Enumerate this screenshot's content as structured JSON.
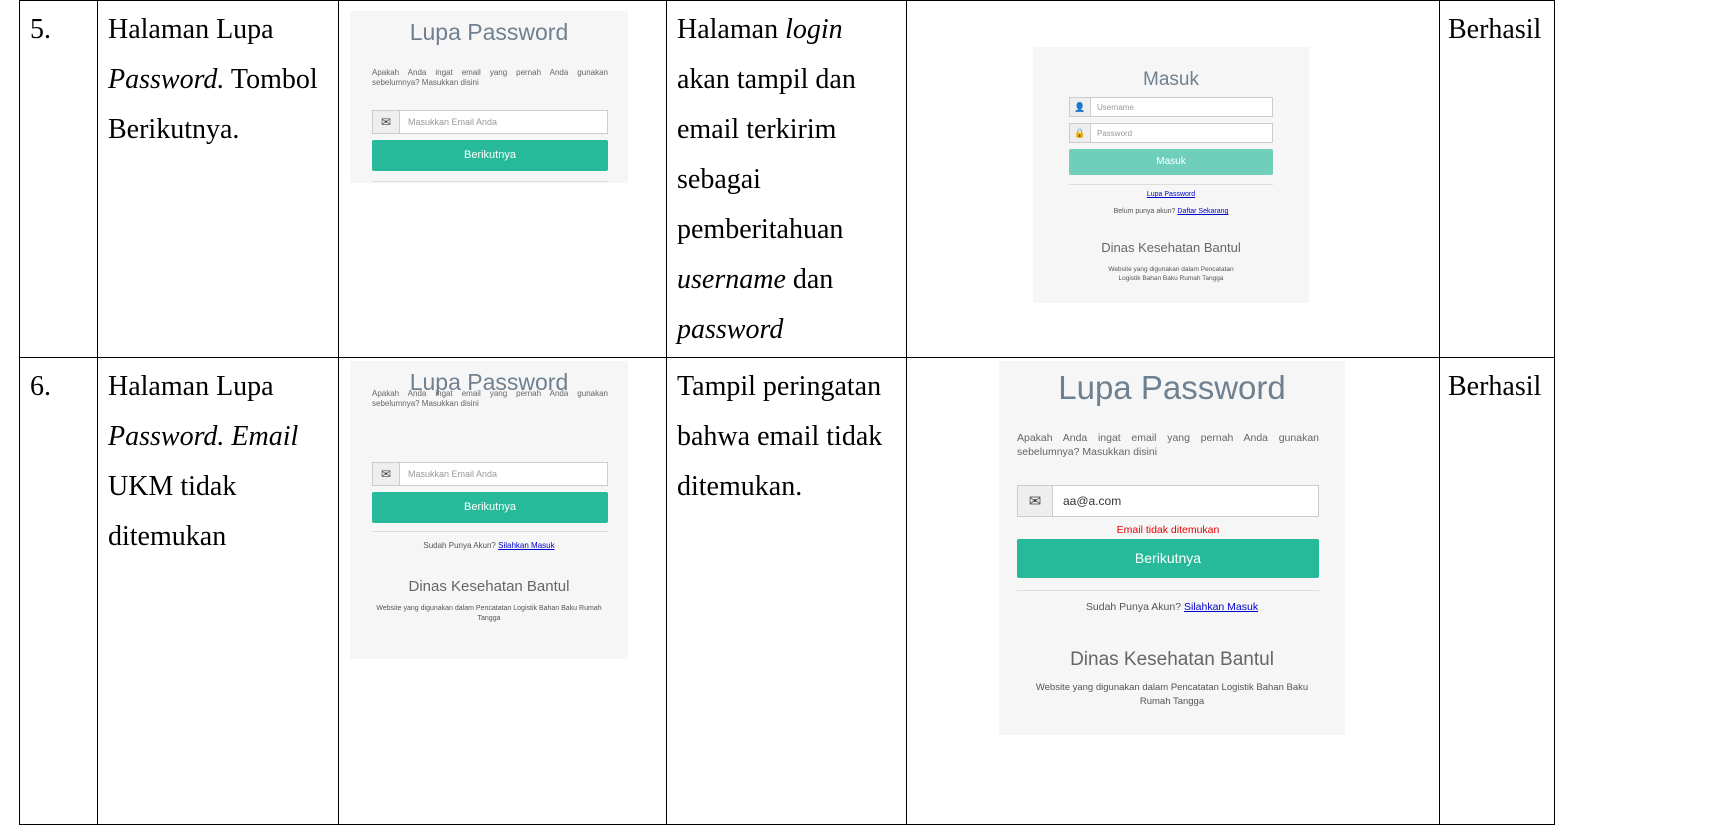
{
  "rows": [
    {
      "no": "5.",
      "scenario": [
        {
          "t": "Halaman Lupa "
        },
        {
          "t": "Password.",
          "i": true
        },
        {
          "t": " Tombol Berikutnya."
        }
      ],
      "expected": [
        {
          "t": "Halaman "
        },
        {
          "t": "login",
          "i": true
        },
        {
          "t": " akan tampil dan email terkirim sebagai pemberitahuan "
        },
        {
          "t": "username",
          "i": true
        },
        {
          "t": " dan "
        },
        {
          "t": "password",
          "i": true
        }
      ],
      "result": "Berhasil"
    },
    {
      "no": "6.",
      "scenario": [
        {
          "t": "Halaman Lupa "
        },
        {
          "t": "Password. Email",
          "i": true
        },
        {
          "t": " UKM tidak ditemukan"
        }
      ],
      "expected": [
        {
          "t": "Tampil peringatan bahwa email tidak ditemukan."
        }
      ],
      "result": "Berhasil"
    }
  ],
  "forgot": {
    "title": "Lupa Password",
    "description": "Apakah Anda ingat email yang pernah Anda gunakan sebelumnya? Masukkan disini",
    "email_placeholder": "Masukkan Email Anda",
    "next_button": "Berikutnya",
    "have_account": "Sudah Punya Akun?",
    "login_link": "Silahkan Masuk",
    "org_name": "Dinas Kesehatan Bantul",
    "org_desc": "Website yang digunakan dalam Pencatatan Logistik Bahan Baku Rumah Tangga",
    "email_value": "aa@a.com",
    "error": "Email tidak ditemukan"
  },
  "login": {
    "title": "Masuk",
    "username_placeholder": "Username",
    "password_placeholder": "Password",
    "login_button": "Masuk",
    "forgot_link": "Lupa Password",
    "no_account": "Belum punya akun?",
    "register_link": "Daftar Sekarang",
    "org_name": "Dinas Kesehatan Bantul",
    "org_desc": "Website yang digunakan dalam Pencatatan Logistik Bahan Baku Rumah Tangga"
  },
  "icons": {
    "envelope": "envelope-icon",
    "user": "user-icon",
    "lock": "lock-icon"
  },
  "colors": {
    "button": "#26b99a",
    "button_light": "#6fcfba",
    "error": "#e00000",
    "link": "#0000cc",
    "title": "#6f8190"
  }
}
